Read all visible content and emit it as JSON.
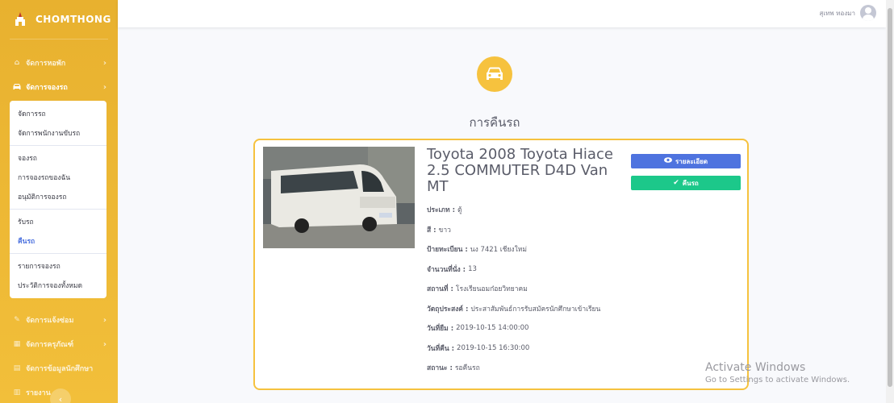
{
  "brand": {
    "name": "CHOMTHONG"
  },
  "sidebar": {
    "items": [
      {
        "label": "จัดการหอพัก",
        "icon": "home-icon"
      },
      {
        "label": "จัดการจองรถ",
        "icon": "car-icon"
      },
      {
        "label": "จัดการแจ้งซ่อม",
        "icon": "wrench-icon"
      },
      {
        "label": "จัดการครุภัณฑ์",
        "icon": "table-icon"
      },
      {
        "label": "จัดการข้อมูลนักศึกษา",
        "icon": "user-table-icon"
      },
      {
        "label": "รายงาน",
        "icon": "chart-icon"
      }
    ],
    "submenu": [
      "จัดการรถ",
      "จัดการพนักงานขับรถ",
      "จองรถ",
      "การจองรถของฉัน",
      "อนุมัติการจองรถ",
      "รับรถ",
      "คืนรถ",
      "รายการจองรถ",
      "ประวัติการจองทั้งหมด"
    ]
  },
  "topbar": {
    "user_name": "สุเทพ ทองมา"
  },
  "page": {
    "title": "การคืนรถ"
  },
  "vehicle": {
    "title": "Toyota 2008 Toyota Hiace 2.5 COMMUTER D4D Van MT",
    "fields": [
      {
        "label": "ประเภท :",
        "value": "ตู้"
      },
      {
        "label": "สี :",
        "value": "ขาว"
      },
      {
        "label": "ป้ายทะเบียน :",
        "value": "นง 7421 เชียงใหม่"
      },
      {
        "label": "จำนวนที่นั่ง :",
        "value": "13"
      },
      {
        "label": "สถานที่ :",
        "value": "โรงเรียนอมก๋อยวิทยาคม"
      },
      {
        "label": "วัตถุประสงค์ :",
        "value": "ประสาสัมพันธ์การรับสมัครนักศึกษาเข้าเรียน"
      },
      {
        "label": "วันที่ยืม :",
        "value": "2019-10-15 14:00:00"
      },
      {
        "label": "วันที่คืน :",
        "value": "2019-10-15 16:30:00"
      },
      {
        "label": "สถานะ :",
        "value": "รอคืนรถ"
      }
    ]
  },
  "actions": {
    "detail_label": "รายละเอียด",
    "return_label": "คืนรถ"
  },
  "watermark": {
    "line1": "Activate Windows",
    "line2": "Go to Settings to activate Windows."
  },
  "colors": {
    "sidebar": "#f0b83a",
    "primary": "#4e73df",
    "success": "#1cc88a",
    "warning": "#f6c23e"
  }
}
